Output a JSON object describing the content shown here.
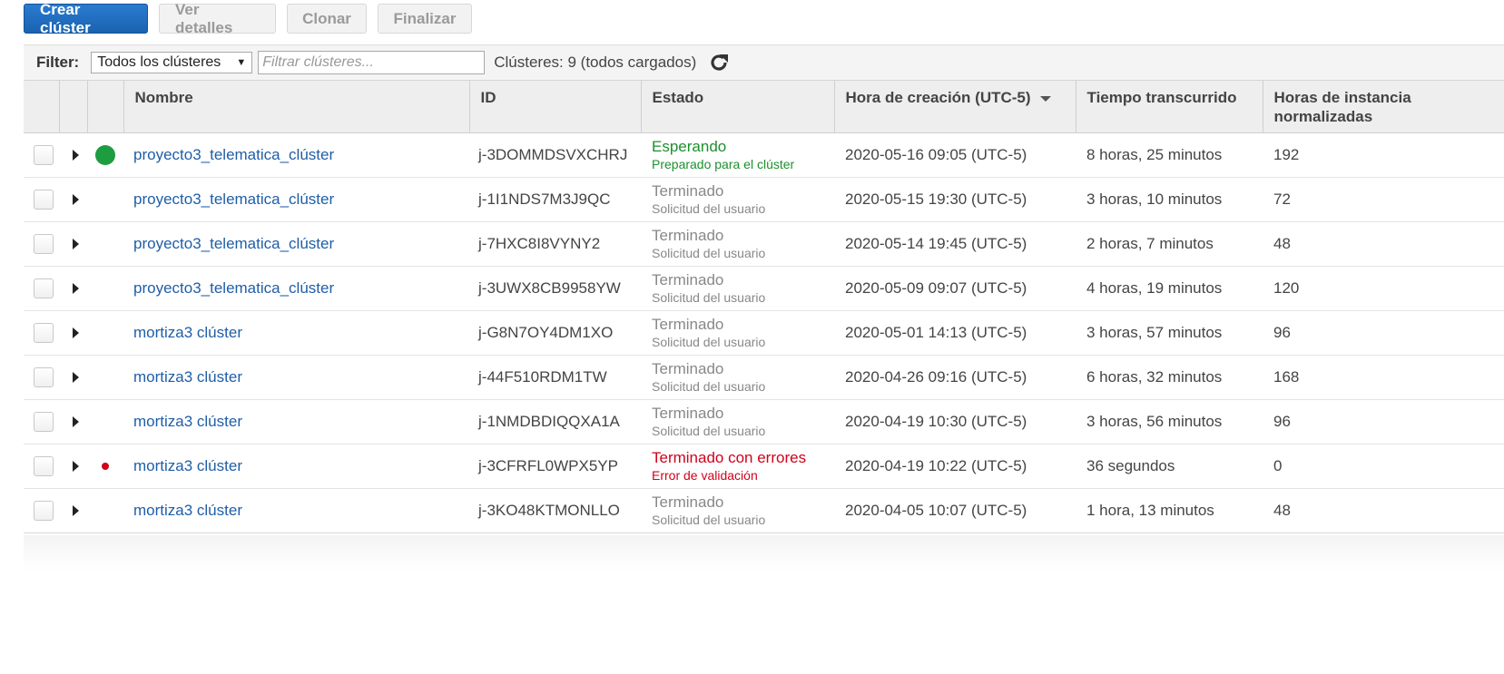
{
  "toolbar": {
    "create_label": "Crear clúster",
    "details_label": "Ver detalles",
    "clone_label": "Clonar",
    "finish_label": "Finalizar"
  },
  "filter": {
    "label": "Filter:",
    "select_value": "Todos los clústeres",
    "search_placeholder": "Filtrar clústeres...",
    "count_text": "Clústeres: 9 (todos cargados)"
  },
  "columns": {
    "name": "Nombre",
    "id": "ID",
    "status": "Estado",
    "created": "Hora de creación (UTC-5)",
    "elapsed": "Tiempo transcurrido",
    "hours": "Horas de instancia normalizadas"
  },
  "rows": [
    {
      "indicator": "running",
      "name": "proyecto3_telematica_clúster",
      "id": "j-3DOMMDSVXCHRJ",
      "status": "Esperando",
      "substatus": "Preparado para el clúster",
      "status_color": "#1d8f2e",
      "created": "2020-05-16 09:05 (UTC-5)",
      "elapsed": "8 horas, 25 minutos",
      "hours": "192"
    },
    {
      "indicator": "none",
      "name": "proyecto3_telematica_clúster",
      "id": "j-1I1NDS7M3J9QC",
      "status": "Terminado",
      "substatus": "Solicitud del usuario",
      "status_color": "#888888",
      "created": "2020-05-15 19:30 (UTC-5)",
      "elapsed": "3 horas, 10 minutos",
      "hours": "72"
    },
    {
      "indicator": "none",
      "name": "proyecto3_telematica_clúster",
      "id": "j-7HXC8I8VYNY2",
      "status": "Terminado",
      "substatus": "Solicitud del usuario",
      "status_color": "#888888",
      "created": "2020-05-14 19:45 (UTC-5)",
      "elapsed": "2 horas, 7 minutos",
      "hours": "48"
    },
    {
      "indicator": "none",
      "name": "proyecto3_telematica_clúster",
      "id": "j-3UWX8CB9958YW",
      "status": "Terminado",
      "substatus": "Solicitud del usuario",
      "status_color": "#888888",
      "created": "2020-05-09 09:07 (UTC-5)",
      "elapsed": "4 horas, 19 minutos",
      "hours": "120"
    },
    {
      "indicator": "none",
      "name": "mortiza3 clúster",
      "id": "j-G8N7OY4DM1XO",
      "status": "Terminado",
      "substatus": "Solicitud del usuario",
      "status_color": "#888888",
      "created": "2020-05-01 14:13 (UTC-5)",
      "elapsed": "3 horas, 57 minutos",
      "hours": "96"
    },
    {
      "indicator": "none",
      "name": "mortiza3 clúster",
      "id": "j-44F510RDM1TW",
      "status": "Terminado",
      "substatus": "Solicitud del usuario",
      "status_color": "#888888",
      "created": "2020-04-26 09:16 (UTC-5)",
      "elapsed": "6 horas, 32 minutos",
      "hours": "168"
    },
    {
      "indicator": "none",
      "name": "mortiza3 clúster",
      "id": "j-1NMDBDIQQXA1A",
      "status": "Terminado",
      "substatus": "Solicitud del usuario",
      "status_color": "#888888",
      "created": "2020-04-19 10:30 (UTC-5)",
      "elapsed": "3 horas, 56 minutos",
      "hours": "96"
    },
    {
      "indicator": "error",
      "name": "mortiza3 clúster",
      "id": "j-3CFRFL0WPX5YP",
      "status": "Terminado con errores",
      "substatus": "Error de validación",
      "status_color": "#d0021b",
      "created": "2020-04-19 10:22 (UTC-5)",
      "elapsed": "36 segundos",
      "hours": "0"
    },
    {
      "indicator": "none",
      "name": "mortiza3 clúster",
      "id": "j-3KO48KTMONLLO",
      "status": "Terminado",
      "substatus": "Solicitud del usuario",
      "status_color": "#888888",
      "created": "2020-04-05 10:07 (UTC-5)",
      "elapsed": "1 hora, 13 minutos",
      "hours": "48"
    }
  ]
}
